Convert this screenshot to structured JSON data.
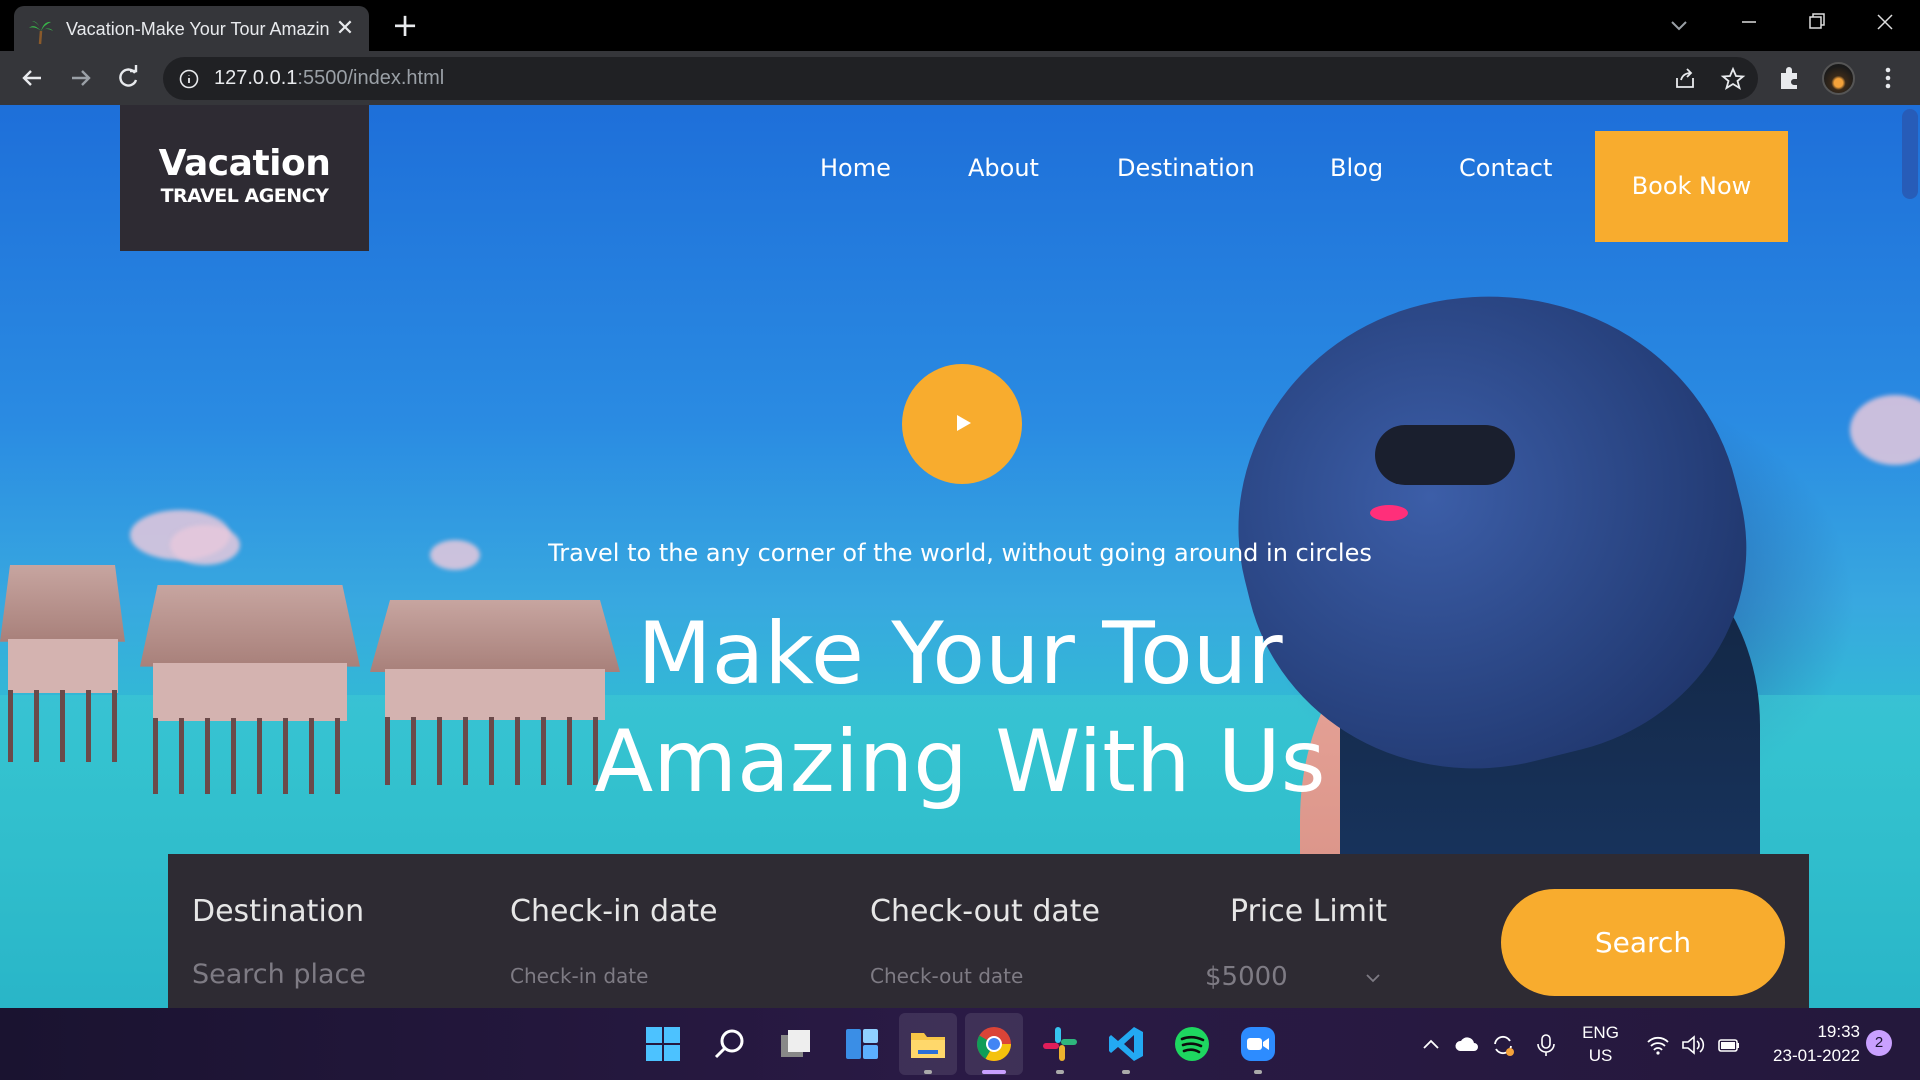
{
  "browser": {
    "tab_title": "Vacation-Make Your Tour Amazin",
    "url_host": "127.0.0.1",
    "url_rest": ":5500/index.html"
  },
  "site": {
    "logo_main": "Vacation",
    "logo_sub": "TRAVEL AGENCY",
    "nav": [
      {
        "label": "Home"
      },
      {
        "label": "About"
      },
      {
        "label": "Destination"
      },
      {
        "label": "Blog"
      },
      {
        "label": "Contact"
      }
    ],
    "book_now": "Book Now",
    "tagline": "Travel to the any corner of the world, without going around in circles",
    "headline_line1": "Make Your Tour",
    "headline_line2": "Amazing With Us",
    "accent_color": "#f8ac2e"
  },
  "search_panel": {
    "destination_label": "Destination",
    "destination_placeholder": "Search place",
    "checkin_label": "Check-in date",
    "checkin_placeholder": "Check-in date",
    "checkout_label": "Check-out date",
    "checkout_placeholder": "Check-out date",
    "price_label": "Price Limit",
    "price_value": "$5000",
    "search_button": "Search"
  },
  "taskbar": {
    "lang_top": "ENG",
    "lang_bottom": "US",
    "time": "19:33",
    "date": "23-01-2022",
    "notifications": "2"
  }
}
